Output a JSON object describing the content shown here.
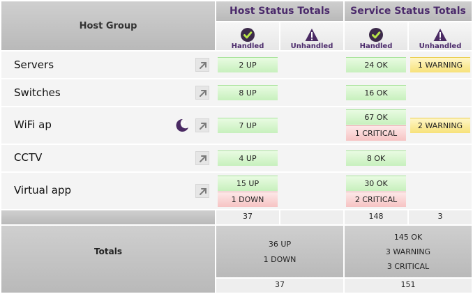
{
  "header": {
    "host_group_label": "Host Group",
    "host_status_title": "Host Status Totals",
    "service_status_title": "Service Status Totals",
    "handled_label": "Handled",
    "unhandled_label": "Unhandled"
  },
  "rows": [
    {
      "name": "Servers",
      "host_handled": [
        "2 UP"
      ],
      "service_handled": [
        "24 OK"
      ],
      "service_unhandled": [
        "1 WARNING"
      ]
    },
    {
      "name": "Switches",
      "host_handled": [
        "8 UP"
      ],
      "service_handled": [
        "16 OK"
      ]
    },
    {
      "name": "WiFi ap",
      "host_handled": [
        "7 UP"
      ],
      "service_handled": [
        "67 OK",
        "1 CRITICAL"
      ],
      "service_unhandled": [
        "2 WARNING"
      ]
    },
    {
      "name": "CCTV",
      "host_handled": [
        "4 UP"
      ],
      "service_handled": [
        "8 OK"
      ]
    },
    {
      "name": "Virtual app",
      "host_handled": [
        "15 UP",
        "1 DOWN"
      ],
      "service_handled": [
        "30 OK",
        "2 CRITICAL"
      ]
    }
  ],
  "sums": {
    "host_handled": "37",
    "service_handled": "148",
    "service_unhandled": "3"
  },
  "totals": {
    "label": "Totals",
    "host_lines": [
      "36 UP",
      "1 DOWN"
    ],
    "service_lines": [
      "145 OK",
      "3 WARNING",
      "3 CRITICAL"
    ],
    "host_total": "37",
    "service_total": "151"
  },
  "icons": {
    "handled": "check-circle-icon",
    "unhandled": "warning-triangle-icon",
    "link": "arrow-up-right-icon",
    "sleep": "moon-zz-icon"
  },
  "colors": {
    "accent": "#4b2a6b",
    "ok_bg": "#d7f5cf",
    "critical_bg": "#f9d2d2",
    "warning_bg": "#f9e8a3"
  }
}
